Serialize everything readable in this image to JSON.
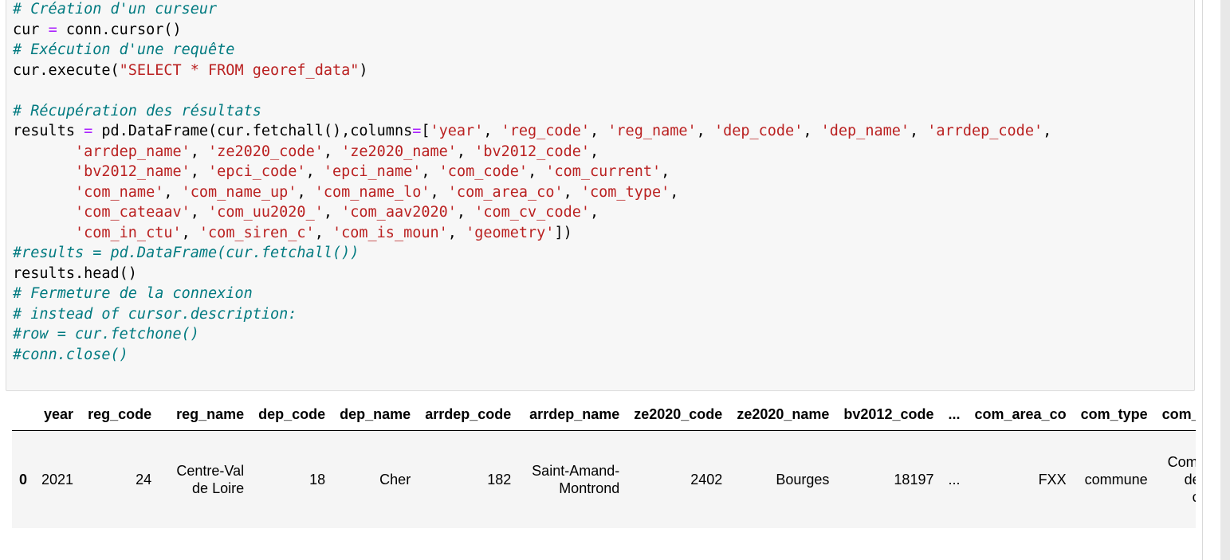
{
  "code_lines": [
    [
      {
        "t": "# Création d'un curseur",
        "c": "cm"
      }
    ],
    [
      {
        "t": "cur ",
        "c": ""
      },
      {
        "t": "=",
        "c": "op"
      },
      {
        "t": " conn.cursor()",
        "c": ""
      }
    ],
    [
      {
        "t": "# Exécution d'une requête",
        "c": "cm"
      }
    ],
    [
      {
        "t": "cur.execute(",
        "c": ""
      },
      {
        "t": "\"SELECT * FROM georef_data\"",
        "c": "str"
      },
      {
        "t": ")",
        "c": ""
      }
    ],
    [
      {
        "t": "",
        "c": ""
      }
    ],
    [
      {
        "t": "# Récupération des résultats",
        "c": "cm"
      }
    ],
    [
      {
        "t": "results ",
        "c": ""
      },
      {
        "t": "=",
        "c": "op"
      },
      {
        "t": " pd.DataFrame(cur.fetchall(),columns",
        "c": ""
      },
      {
        "t": "=",
        "c": "op"
      },
      {
        "t": "[",
        "c": ""
      },
      {
        "t": "'year'",
        "c": "str"
      },
      {
        "t": ", ",
        "c": ""
      },
      {
        "t": "'reg_code'",
        "c": "str"
      },
      {
        "t": ", ",
        "c": ""
      },
      {
        "t": "'reg_name'",
        "c": "str"
      },
      {
        "t": ", ",
        "c": ""
      },
      {
        "t": "'dep_code'",
        "c": "str"
      },
      {
        "t": ", ",
        "c": ""
      },
      {
        "t": "'dep_name'",
        "c": "str"
      },
      {
        "t": ", ",
        "c": ""
      },
      {
        "t": "'arrdep_code'",
        "c": "str"
      },
      {
        "t": ",",
        "c": ""
      }
    ],
    [
      {
        "t": "       ",
        "c": ""
      },
      {
        "t": "'arrdep_name'",
        "c": "str"
      },
      {
        "t": ", ",
        "c": ""
      },
      {
        "t": "'ze2020_code'",
        "c": "str"
      },
      {
        "t": ", ",
        "c": ""
      },
      {
        "t": "'ze2020_name'",
        "c": "str"
      },
      {
        "t": ", ",
        "c": ""
      },
      {
        "t": "'bv2012_code'",
        "c": "str"
      },
      {
        "t": ",",
        "c": ""
      }
    ],
    [
      {
        "t": "       ",
        "c": ""
      },
      {
        "t": "'bv2012_name'",
        "c": "str"
      },
      {
        "t": ", ",
        "c": ""
      },
      {
        "t": "'epci_code'",
        "c": "str"
      },
      {
        "t": ", ",
        "c": ""
      },
      {
        "t": "'epci_name'",
        "c": "str"
      },
      {
        "t": ", ",
        "c": ""
      },
      {
        "t": "'com_code'",
        "c": "str"
      },
      {
        "t": ", ",
        "c": ""
      },
      {
        "t": "'com_current'",
        "c": "str"
      },
      {
        "t": ",",
        "c": ""
      }
    ],
    [
      {
        "t": "       ",
        "c": ""
      },
      {
        "t": "'com_name'",
        "c": "str"
      },
      {
        "t": ", ",
        "c": ""
      },
      {
        "t": "'com_name_up'",
        "c": "str"
      },
      {
        "t": ", ",
        "c": ""
      },
      {
        "t": "'com_name_lo'",
        "c": "str"
      },
      {
        "t": ", ",
        "c": ""
      },
      {
        "t": "'com_area_co'",
        "c": "str"
      },
      {
        "t": ", ",
        "c": ""
      },
      {
        "t": "'com_type'",
        "c": "str"
      },
      {
        "t": ",",
        "c": ""
      }
    ],
    [
      {
        "t": "       ",
        "c": ""
      },
      {
        "t": "'com_cateaav'",
        "c": "str"
      },
      {
        "t": ", ",
        "c": ""
      },
      {
        "t": "'com_uu2020_'",
        "c": "str"
      },
      {
        "t": ", ",
        "c": ""
      },
      {
        "t": "'com_aav2020'",
        "c": "str"
      },
      {
        "t": ", ",
        "c": ""
      },
      {
        "t": "'com_cv_code'",
        "c": "str"
      },
      {
        "t": ",",
        "c": ""
      }
    ],
    [
      {
        "t": "       ",
        "c": ""
      },
      {
        "t": "'com_in_ctu'",
        "c": "str"
      },
      {
        "t": ", ",
        "c": ""
      },
      {
        "t": "'com_siren_c'",
        "c": "str"
      },
      {
        "t": ", ",
        "c": ""
      },
      {
        "t": "'com_is_moun'",
        "c": "str"
      },
      {
        "t": ", ",
        "c": ""
      },
      {
        "t": "'geometry'",
        "c": "str"
      },
      {
        "t": "])",
        "c": ""
      }
    ],
    [
      {
        "t": "#results = pd.DataFrame(cur.fetchall())",
        "c": "cm"
      }
    ],
    [
      {
        "t": "results.head()",
        "c": ""
      }
    ],
    [
      {
        "t": "# Fermeture de la connexion",
        "c": "cm"
      }
    ],
    [
      {
        "t": "# instead of cursor.description:",
        "c": "cm"
      }
    ],
    [
      {
        "t": "#row = cur.fetchone()",
        "c": "cm"
      }
    ],
    [
      {
        "t": "#conn.close()",
        "c": "cm"
      }
    ]
  ],
  "table": {
    "index_header": "",
    "columns": [
      "year",
      "reg_code",
      "reg_name",
      "dep_code",
      "dep_name",
      "arrdep_code",
      "arrdep_name",
      "ze2020_code",
      "ze2020_name",
      "bv2012_code",
      "...",
      "com_area_co",
      "com_type",
      "com_ca"
    ],
    "rows": [
      {
        "index": "0",
        "cells": [
          "2021",
          "24",
          "Centre-Val de Loire",
          "18",
          "Cher",
          "182",
          "Saint-Amand-Montrond",
          "2402",
          "Bourges",
          "18197",
          "...",
          "FXX",
          "commune",
          "Commune de la cou"
        ]
      }
    ]
  }
}
